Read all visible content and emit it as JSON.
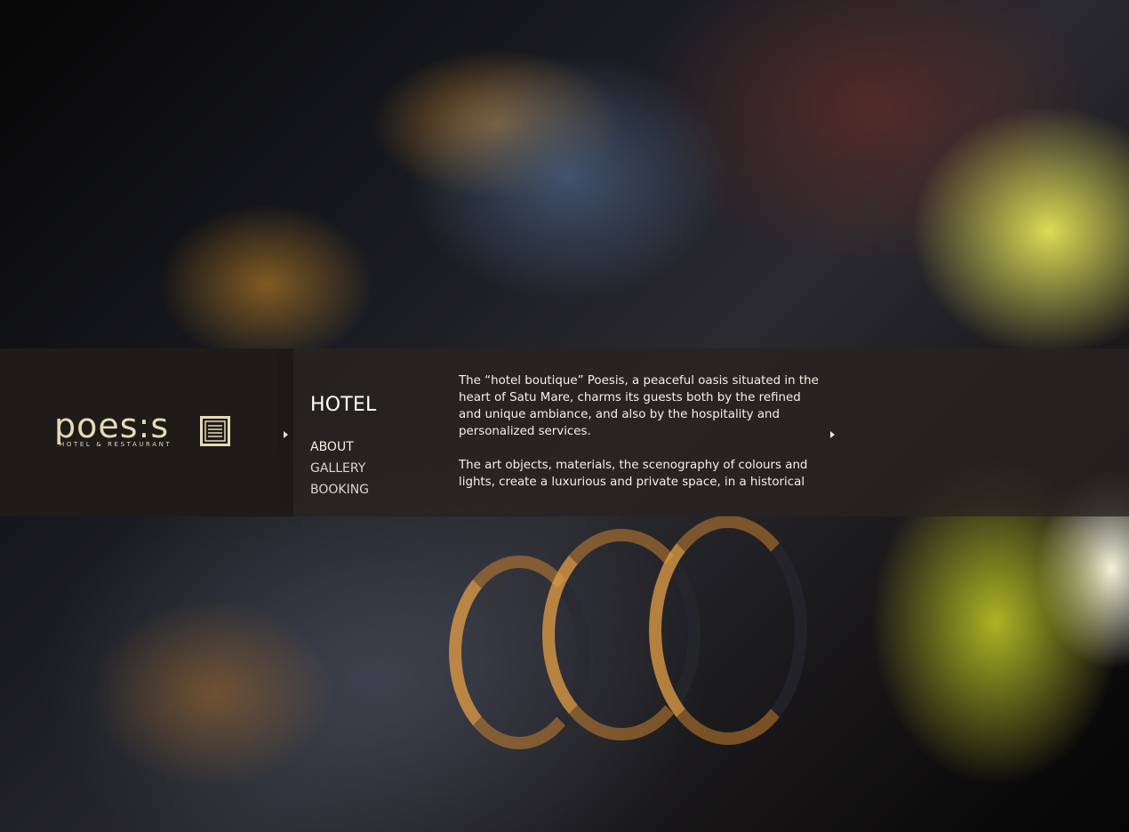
{
  "logo": {
    "name": "poes:s",
    "tagline": "HOTEL & RESTAURANT",
    "color": "#e7dbb6"
  },
  "section": {
    "title": "HOTEL"
  },
  "nav": {
    "items": [
      {
        "label": "ABOUT"
      },
      {
        "label": "GALLERY"
      },
      {
        "label": "BOOKING"
      }
    ]
  },
  "content": {
    "paragraphs": [
      "The “hotel boutique” Poesis, a peaceful oasis situated in the heart of Satu Mare, charms its guests both by the refined and unique ambiance, and also by the hospitality and personalized services.",
      "The art objects, materials, the scenography of colours and lights, create a luxurious and private space, in a historical"
    ]
  },
  "icons": {
    "nav_arrow": "right-triangle-icon",
    "content_arrow": "right-triangle-icon",
    "logo_mark": "book-emblem-icon"
  },
  "colors": {
    "band_overlay": "rgba(40,35,32,0.80)",
    "brand_panel": "#1f1b18",
    "text": "#f4f1ea"
  }
}
